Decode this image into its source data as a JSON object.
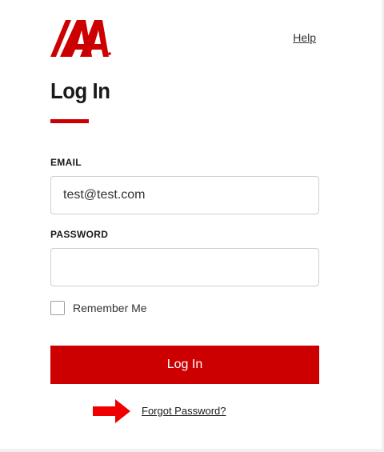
{
  "header": {
    "logo_icon": "iaa-logo-icon",
    "help_label": "Help"
  },
  "page": {
    "title": "Log In"
  },
  "form": {
    "email_label": "EMAIL",
    "email_value": "test@test.com",
    "password_label": "PASSWORD",
    "password_value": "",
    "remember_label": "Remember Me",
    "remember_checked": false,
    "submit_label": "Log In",
    "forgot_label": "Forgot Password?"
  },
  "annotation": {
    "arrow_icon": "arrow-right-icon"
  },
  "colors": {
    "brand_red": "#cc0000",
    "text_dark": "#1a1a1a",
    "input_border": "#cfcfcf"
  }
}
